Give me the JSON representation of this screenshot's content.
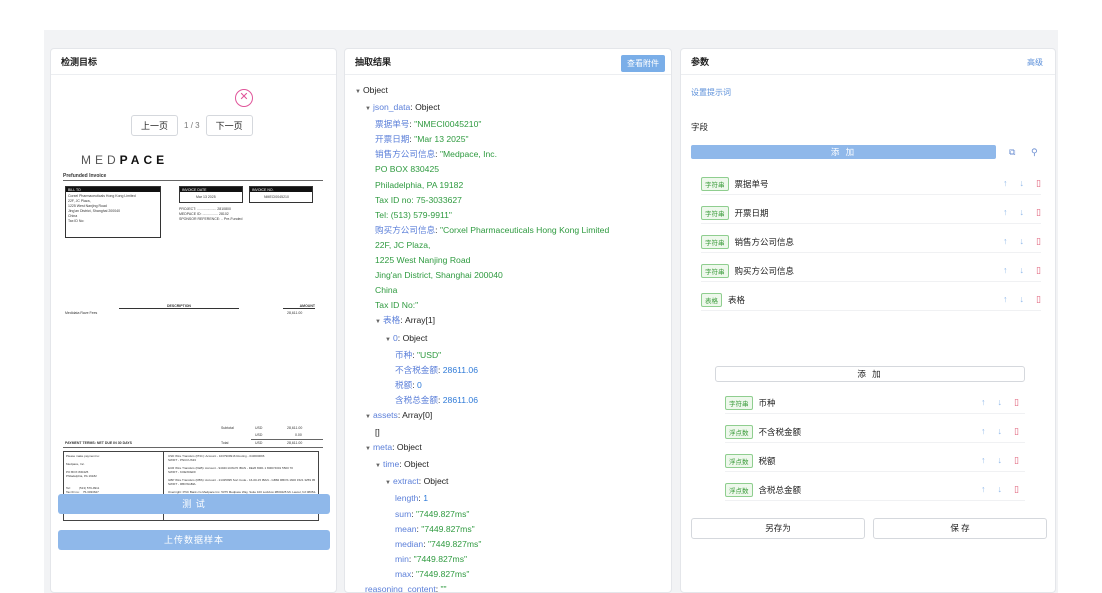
{
  "panel1": {
    "title": "检测目标",
    "prev_label": "上一页",
    "page_indicator": "1 / 3",
    "next_label": "下一页",
    "test_label": "测 试",
    "upload_label": "上传数据样本",
    "invoice": {
      "logo_prefix": "MED",
      "logo_suffix": "PACE",
      "title": "Prefunded Invoice",
      "bill_to": "BILL TO",
      "bill_text": "Corxel Pharmaceuticals Hong Kong Limited\n22F, JC Plaza,\n1225 West Nanjing Road\nJing'an District, Shanghai 200040\nChina\nTax ID No:",
      "invoice_date_label": "INVOICE DATE",
      "invoice_date": "Mar 13 2025",
      "invoice_no_label": "INVOICE NO.",
      "invoice_no": "NMECI0045210",
      "project_text": "PROJECT: .................... 2810800\nMEDPACE ID: ................ 28102\nSPONSOR REFERENCE: .. Pre-Funded",
      "desc_label": "DESCRIPTION",
      "amount_label": "AMOUNT",
      "line_item": "Medidata Rave Fees",
      "line_amount": "28,611.00",
      "subtotal_label": "Subtotal",
      "currency": "USD",
      "subtotal": "28,611.00",
      "tax": "0.00",
      "total_label": "Total",
      "total": "28,611.00",
      "payment_terms": "PAYMENT TERMS: NET DUE IN 30 DAYS",
      "pay_to": "Please make payment to:\n\nMedpace, Inc.\n\nPO BOX 830425\nPhiladelphia, PA 19182\n\n\nTel:          (513) 579-9911\nTax ID no:    75-3033627",
      "bank_text": "USD Wire Transfers (PNC): Account - 1037909916 Routing - 043000096\nSWIFT - PNCCUS33\n\nEUR Wire Transfers (KEB): Account - 9404C1C8A70 IBAN - DE26 8001 1 8000 5001 5500 70\nSWIFT - KOEXDEFF\n\nGBP Wire Transfers (RBS): Account - 21325995 Sort Code - 16-00-15 IBAN - GB82 RBOS 1600 1521 3259 95\nSWIFT - RBOSGB2L\n\nOvernight: PNC Bank c/o Medpace Inc. 5375 Medpace Way, Suite 100 Lockbox #830425 Mt. Laurel, NJ 08054-3979"
    }
  },
  "panel2": {
    "title": "抽取结果",
    "view_attachment": "查看附件",
    "tree": [
      {
        "indent": 0,
        "arrow": true,
        "key": "Object",
        "sep": "",
        "value": "",
        "vtype": "k0"
      },
      {
        "indent": 1,
        "arrow": true,
        "key": "json_data",
        "sep": ": ",
        "value": "Object",
        "vtype": "k0"
      },
      {
        "indent": 2,
        "arrow": false,
        "key": "票据单号",
        "sep": ": ",
        "value": "\"NMECI0045210\"",
        "vtype": "s"
      },
      {
        "indent": 2,
        "arrow": false,
        "key": "开票日期",
        "sep": ": ",
        "value": "\"Mar 13 2025\"",
        "vtype": "s"
      },
      {
        "indent": 2,
        "arrow": false,
        "key": "销售方公司信息",
        "sep": ": ",
        "value": "\"Medpace, Inc.",
        "vtype": "s"
      },
      {
        "indent": 2,
        "arrow": false,
        "key": "",
        "sep": "",
        "value": "PO BOX 830425",
        "vtype": "s"
      },
      {
        "indent": 2,
        "arrow": false,
        "key": "",
        "sep": "",
        "value": "Philadelphia, PA 19182",
        "vtype": "s"
      },
      {
        "indent": 2,
        "arrow": false,
        "key": "",
        "sep": "",
        "value": "Tax ID no: 75-3033627",
        "vtype": "s"
      },
      {
        "indent": 2,
        "arrow": false,
        "key": "",
        "sep": "",
        "value": "Tel: (513) 579-9911\"",
        "vtype": "s"
      },
      {
        "indent": 2,
        "arrow": false,
        "key": "购买方公司信息",
        "sep": ": ",
        "value": "\"Corxel Pharmaceuticals Hong Kong Limited",
        "vtype": "s"
      },
      {
        "indent": 2,
        "arrow": false,
        "key": "",
        "sep": "",
        "value": "22F, JC Plaza,",
        "vtype": "s"
      },
      {
        "indent": 2,
        "arrow": false,
        "key": "",
        "sep": "",
        "value": "1225 West Nanjing Road",
        "vtype": "s"
      },
      {
        "indent": 2,
        "arrow": false,
        "key": "",
        "sep": "",
        "value": "Jing'an District, Shanghai 200040",
        "vtype": "s"
      },
      {
        "indent": 2,
        "arrow": false,
        "key": "",
        "sep": "",
        "value": "China",
        "vtype": "s"
      },
      {
        "indent": 2,
        "arrow": false,
        "key": "",
        "sep": "",
        "value": "Tax ID No:\"",
        "vtype": "s"
      },
      {
        "indent": 2,
        "arrow": true,
        "key": "表格",
        "sep": ": ",
        "value": "Array[1]",
        "vtype": "k0"
      },
      {
        "indent": 3,
        "arrow": true,
        "key": "0",
        "sep": ": ",
        "value": "Object",
        "vtype": "k0"
      },
      {
        "indent": 4,
        "arrow": false,
        "key": "币种",
        "sep": ": ",
        "value": "\"USD\"",
        "vtype": "s"
      },
      {
        "indent": 4,
        "arrow": false,
        "key": "不含税金额",
        "sep": ": ",
        "value": "28611.06",
        "vtype": "n"
      },
      {
        "indent": 4,
        "arrow": false,
        "key": "税额",
        "sep": ": ",
        "value": "0",
        "vtype": "n"
      },
      {
        "indent": 4,
        "arrow": false,
        "key": "含税总金额",
        "sep": ": ",
        "value": "28611.06",
        "vtype": "n"
      },
      {
        "indent": 1,
        "arrow": true,
        "key": "assets",
        "sep": ": ",
        "value": "Array[0]",
        "vtype": "k0"
      },
      {
        "indent": 2,
        "arrow": false,
        "key": "",
        "sep": "",
        "value": "[]",
        "vtype": "k0"
      },
      {
        "indent": 1,
        "arrow": true,
        "key": "meta",
        "sep": ": ",
        "value": "Object",
        "vtype": "k0"
      },
      {
        "indent": 2,
        "arrow": true,
        "key": "time",
        "sep": ": ",
        "value": "Object",
        "vtype": "k0"
      },
      {
        "indent": 3,
        "arrow": true,
        "key": "extract",
        "sep": ": ",
        "value": "Object",
        "vtype": "k0"
      },
      {
        "indent": 4,
        "arrow": false,
        "key": "length",
        "sep": ": ",
        "value": "1",
        "vtype": "n"
      },
      {
        "indent": 4,
        "arrow": false,
        "key": "sum",
        "sep": ": ",
        "value": "\"7449.827ms\"",
        "vtype": "s"
      },
      {
        "indent": 4,
        "arrow": false,
        "key": "mean",
        "sep": ": ",
        "value": "\"7449.827ms\"",
        "vtype": "s"
      },
      {
        "indent": 4,
        "arrow": false,
        "key": "median",
        "sep": ": ",
        "value": "\"7449.827ms\"",
        "vtype": "s"
      },
      {
        "indent": 4,
        "arrow": false,
        "key": "min",
        "sep": ": ",
        "value": "\"7449.827ms\"",
        "vtype": "s"
      },
      {
        "indent": 4,
        "arrow": false,
        "key": "max",
        "sep": ": ",
        "value": "\"7449.827ms\"",
        "vtype": "s"
      },
      {
        "indent": 1,
        "arrow": false,
        "key": "reasoning_content",
        "sep": ": ",
        "value": "\"\"",
        "vtype": "s"
      }
    ]
  },
  "panel3": {
    "title": "参数",
    "advanced": "高级",
    "hint_link": "设置提示词",
    "fields_label": "字段",
    "add_label": "添 加",
    "fields": [
      {
        "tag": "字符串",
        "name": "票据单号"
      },
      {
        "tag": "字符串",
        "name": "开票日期"
      },
      {
        "tag": "字符串",
        "name": "销售方公司信息"
      },
      {
        "tag": "字符串",
        "name": "购买方公司信息"
      },
      {
        "tag": "表格",
        "name": "表格"
      }
    ],
    "sub_add_label": "添 加",
    "sub_fields": [
      {
        "tag": "字符串",
        "name": "币种"
      },
      {
        "tag": "浮点数",
        "name": "不含税金额"
      },
      {
        "tag": "浮点数",
        "name": "税额"
      },
      {
        "tag": "浮点数",
        "name": "含税总金额"
      }
    ],
    "save_as_label": "另存为",
    "save_label": "保 存"
  }
}
